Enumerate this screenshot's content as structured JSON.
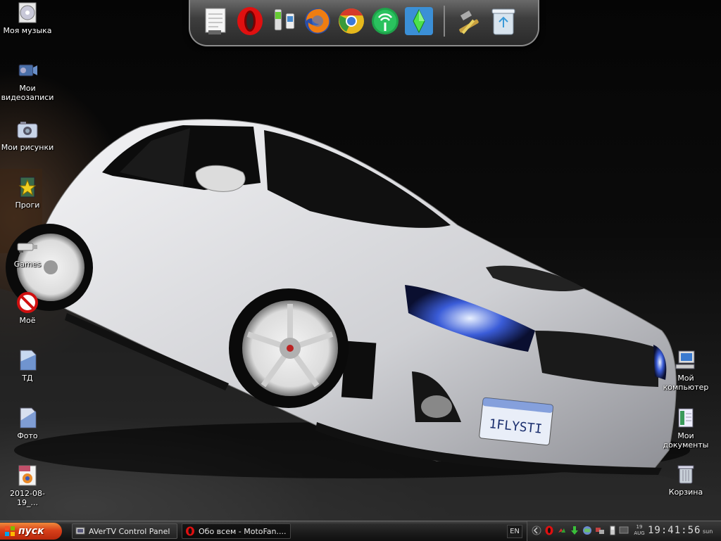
{
  "dock": {
    "items": [
      {
        "name": "notepad-icon"
      },
      {
        "name": "opera-icon"
      },
      {
        "name": "mobile-sync-icon"
      },
      {
        "name": "firefox-icon"
      },
      {
        "name": "chrome-icon"
      },
      {
        "name": "wifi-antenna-icon"
      },
      {
        "name": "sims-plumbob-icon"
      },
      {
        "name": "tools-icon"
      },
      {
        "name": "recycle-bin-icon"
      }
    ]
  },
  "desktop": {
    "left_icons": [
      {
        "label": "Моя музыка",
        "icon": "cd-music-icon"
      },
      {
        "label": "Мои видеозаписи",
        "icon": "camcorder-icon"
      },
      {
        "label": "Мои рисунки",
        "icon": "camera-icon"
      },
      {
        "label": "Проги",
        "icon": "star-folder-icon"
      },
      {
        "label": "Games",
        "icon": "usb-drive-icon"
      },
      {
        "label": "Моё",
        "icon": "no-entry-icon"
      },
      {
        "label": "ТД",
        "icon": "document-blue-icon"
      },
      {
        "label": "Фото",
        "icon": "photo-document-icon"
      },
      {
        "label": "2012-08-19_...",
        "icon": "png-file-icon"
      }
    ],
    "right_icons": [
      {
        "label": "Мой компьютер",
        "icon": "my-computer-icon"
      },
      {
        "label": "Мои документы",
        "icon": "my-documents-icon"
      },
      {
        "label": "Корзина",
        "icon": "recycle-bin-icon"
      }
    ]
  },
  "wallpaper": {
    "license_plate": "1FLYSTI"
  },
  "taskbar": {
    "start_label": "пуск",
    "tasks": [
      {
        "label": "AVerTV Control Panel",
        "icon": "avertv-icon",
        "active": false
      },
      {
        "label": "Обо всем - MotoFan....",
        "icon": "opera-icon",
        "active": true
      }
    ],
    "language": "EN",
    "tray_icons": [
      "chevron-left-icon",
      "opera-tray-icon",
      "arrows-tray-icon",
      "download-tray-icon",
      "globe-tray-icon",
      "network-tray-icon",
      "battery-tray-icon",
      "monitor-tray-icon"
    ],
    "clock": {
      "day": "19",
      "month": "AUG",
      "time": "19:41:56",
      "weekday": "sun"
    }
  },
  "colors": {
    "start_button": "#d8401a",
    "taskbar": "#1b1b1b",
    "car": "#e8e8ea"
  }
}
